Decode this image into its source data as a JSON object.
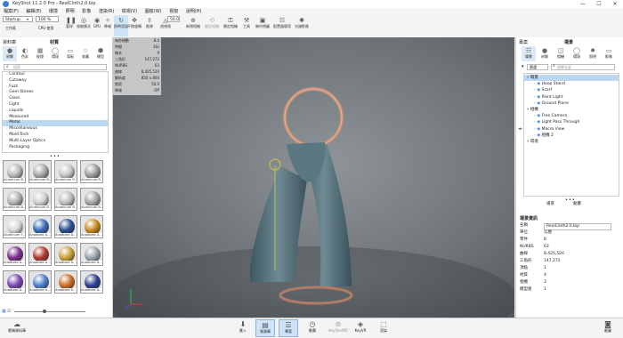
{
  "window": {
    "title": "KeyShot 11.2.0 Pro - RealCloth2.0.bip",
    "controls": {
      "minimize": "—",
      "maximize": "☐",
      "close": "✕"
    }
  },
  "menu": [
    "檔案(F)",
    "編輯(E)",
    "環境",
    "照明",
    "影像",
    "渲染(R)",
    "檢視(V)",
    "圖窗(W)",
    "視窗",
    "說明(H)"
  ],
  "toolbar": {
    "workspace": "Startup",
    "zoom": "100 %",
    "pause_label": "暫停",
    "cpu_label": "CPU 使用",
    "perf_label": "效能模式",
    "gpu_label": "GPU",
    "denoise_label": "降噪",
    "render_label": "即時渲染",
    "viewport_label": "平移旋轉",
    "tumble_label": "推移",
    "dolly_label": "透視角",
    "fov_value": "50.0",
    "btns2": [
      "新增相機",
      "重設相機",
      "鎖定相機",
      "工具",
      "幾何視圖",
      "配置器嚮導",
      "光譜影像"
    ]
  },
  "left": {
    "panel_label": "資料庫",
    "title": "材質",
    "tabs": [
      "材質",
      "色彩",
      "紋理",
      "環境",
      "背板",
      "收藏",
      "模型"
    ],
    "search_placeholder": "搜索",
    "categories": [
      "Contour",
      "Cutaway",
      "Fuzz",
      "Gem Stones",
      "Glass",
      "Light",
      "Liquids",
      "Measured",
      "Metal",
      "Miscellaneous",
      "Mold-Tech",
      "Multi-Layer Optics",
      "Packaging"
    ],
    "selected_index": 8,
    "thumbnails": [
      {
        "label": "Aluminum B…",
        "color": "#b8b8b8"
      },
      {
        "label": "Aluminum B…",
        "color": "#a8a8a8"
      },
      {
        "label": "Aluminum R…",
        "color": "#c6c6c6"
      },
      {
        "label": "Aluminum R…",
        "color": "#9c9c9c"
      },
      {
        "label": "Aluminum B…",
        "color": "#b0b0b0"
      },
      {
        "label": "Aluminum R…",
        "color": "#cfcfcf"
      },
      {
        "label": "Aluminum R…",
        "color": "#bdbdbd"
      },
      {
        "label": "Aluminum R…",
        "color": "#a4a4a4"
      },
      {
        "label": "Aluminum T…",
        "color": "#d8d8d8"
      },
      {
        "label": "Anodized A…",
        "color": "#3b6bb8"
      },
      {
        "label": "Anodized A…",
        "color": "#2a4f8e"
      },
      {
        "label": "Anodized A…",
        "color": "#c88a1c"
      },
      {
        "label": "Anodized A…",
        "color": "#7b2f8a"
      },
      {
        "label": "Anodized A…",
        "color": "#b23a2e"
      },
      {
        "label": "Anodized A…",
        "color": "#c9a232"
      },
      {
        "label": "Anodized A…",
        "color": "#9aa4ac"
      },
      {
        "label": "Anodized A…",
        "color": "#7a4bb5"
      },
      {
        "label": "Anodized A…",
        "color": "#4e7fc9"
      },
      {
        "label": "Anodized A…",
        "color": "#cc6f2a"
      },
      {
        "label": "Anodized A…",
        "color": "#2f3f8f"
      }
    ]
  },
  "stats": [
    {
      "label": "每秒幀數",
      "value": "8.4"
    },
    {
      "label": "時間",
      "value": "16s"
    },
    {
      "label": "樣本",
      "value": "9"
    },
    {
      "label": "三角形",
      "value": "147,272"
    },
    {
      "label": "NURBS",
      "value": "63"
    },
    {
      "label": "曲線",
      "value": "8,425,520"
    },
    {
      "label": "解析度",
      "value": "850 x 860"
    },
    {
      "label": "焦距",
      "value": "50.0"
    },
    {
      "label": "降噪",
      "value": "Off"
    }
  ],
  "right": {
    "panel_label": "專案",
    "title": "場景",
    "tabs": [
      "場景",
      "材質",
      "相機",
      "環境",
      "照明",
      "影像"
    ],
    "filter_label": "篩選",
    "search_placeholder": "搜尋全部",
    "tree": [
      {
        "label": "場景",
        "indent": 0,
        "sel": true
      },
      {
        "label": "Hoop Stand",
        "indent": 2,
        "sel": false
      },
      {
        "label": "Scarf",
        "indent": 2,
        "sel": false
      },
      {
        "label": "Point Light",
        "indent": 2,
        "sel": false
      },
      {
        "label": "Ground Plane",
        "indent": 2,
        "sel": false
      },
      {
        "label": "相機",
        "indent": 0,
        "sel": false
      },
      {
        "label": "Free Camera",
        "indent": 2,
        "sel": false
      },
      {
        "label": "Light Pass Through",
        "indent": 2,
        "sel": false
      },
      {
        "label": "Macro View",
        "indent": 2,
        "sel": false
      },
      {
        "label": "相機 2",
        "indent": 2,
        "sel": false
      },
      {
        "label": "環境",
        "indent": 0,
        "sel": false
      }
    ],
    "bottom_tabs": [
      "場景",
      "動畫"
    ],
    "info_title": "場景資訊",
    "props": [
      {
        "label": "名稱",
        "value": "RealCloth2.0.bip"
      },
      {
        "label": "單位",
        "value": "公厘"
      },
      {
        "label": "零件",
        "value": "8"
      },
      {
        "label": "NURBS",
        "value": "63"
      },
      {
        "label": "曲線",
        "value": "8,425,520"
      },
      {
        "label": "三角形",
        "value": "147,272"
      },
      {
        "label": "頂點",
        "value": "1"
      },
      {
        "label": "材質",
        "value": "4"
      },
      {
        "label": "相機",
        "value": "3"
      },
      {
        "label": "模型組",
        "value": "1"
      }
    ]
  },
  "bottom": {
    "cloud_label": "雲端資料庫",
    "buttons": [
      "匯入",
      "資源庫",
      "專案",
      "動畫",
      "KeyShotXR",
      "KeyVR",
      "渲染"
    ],
    "screenshot_label": "截圖"
  }
}
